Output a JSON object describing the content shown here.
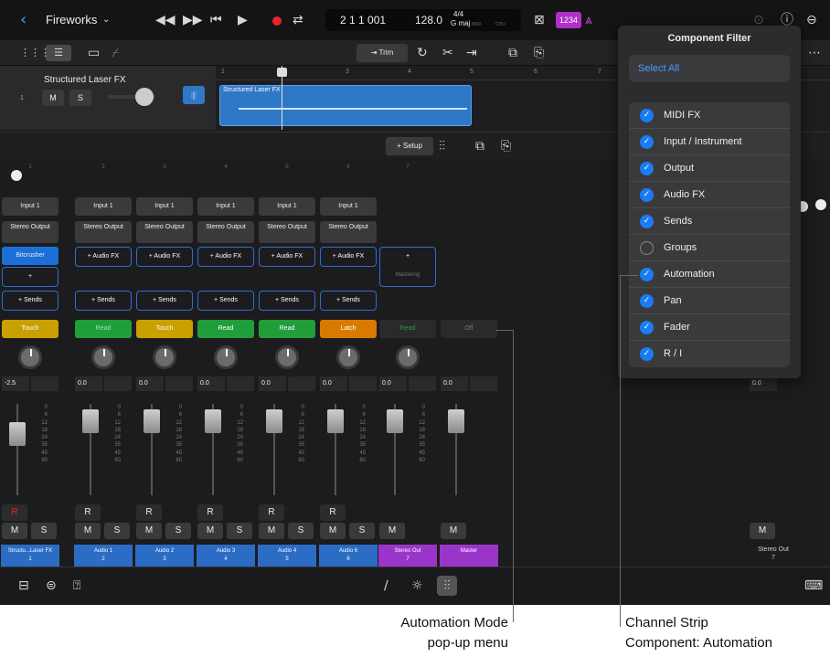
{
  "topbar": {
    "project_title": "Fireworks",
    "lcd_position": "2 1 1 001",
    "lcd_tempo": "128.0",
    "lcd_signature": "4/4",
    "lcd_key": "G maj",
    "lcd_midi": "MIDI",
    "lcd_cpu": "CPU",
    "count_in": "1234"
  },
  "toolbar2": {
    "trim_label": "Trim"
  },
  "track": {
    "number": "1",
    "name": "Structured Laser FX",
    "mute": "M",
    "solo": "S",
    "region_name": "Structured Laser FX",
    "ruler": [
      "1",
      "2",
      "3",
      "4",
      "5",
      "6",
      "7"
    ]
  },
  "mixbar": {
    "setup_label": "Setup"
  },
  "strips": [
    {
      "num": "1",
      "input": "Input 1",
      "output": "Stereo Output",
      "fx": "Bitcrusher",
      "audio_fx_add": "+",
      "sends": "+ Sends",
      "automation": "Touch",
      "pan": "-2.5",
      "rec": "R",
      "mute": "M",
      "solo": "S",
      "name": "Structu...Laser FX",
      "index": "1",
      "color": "#2b6cc4"
    },
    {
      "num": "2",
      "input": "Input 1",
      "output": "Stereo Output",
      "fx": "+ Audio FX",
      "sends": "+ Sends",
      "automation": "Read",
      "pan": "0.0",
      "rec": "R",
      "mute": "M",
      "solo": "S",
      "name": "Audio 1",
      "index": "2",
      "color": "#2b6cc4"
    },
    {
      "num": "3",
      "input": "Input 1",
      "output": "Stereo Output",
      "fx": "+ Audio FX",
      "sends": "+ Sends",
      "automation": "Touch",
      "pan": "0.0",
      "rec": "R",
      "mute": "M",
      "solo": "S",
      "name": "Audio 2",
      "index": "3",
      "color": "#2b6cc4"
    },
    {
      "num": "4",
      "input": "Input 1",
      "output": "Stereo Output",
      "fx": "+ Audio FX",
      "sends": "+ Sends",
      "automation": "Read",
      "pan": "0.0",
      "rec": "R",
      "mute": "M",
      "solo": "S",
      "name": "Audio 3",
      "index": "4",
      "color": "#2b6cc4"
    },
    {
      "num": "5",
      "input": "Input 1",
      "output": "Stereo Output",
      "fx": "+ Audio FX",
      "sends": "+ Sends",
      "automation": "Read",
      "pan": "0.0",
      "rec": "R",
      "mute": "M",
      "solo": "S",
      "name": "Audio 4",
      "index": "5",
      "color": "#2b6cc4"
    },
    {
      "num": "6",
      "input": "Input 1",
      "output": "Stereo Output",
      "fx": "+ Audio FX",
      "sends": "+ Sends",
      "automation": "Latch",
      "pan": "0.0",
      "rec": "R",
      "mute": "M",
      "solo": "S",
      "name": "Audio 6",
      "index": "6",
      "color": "#2b6cc4"
    },
    {
      "num": "7",
      "fx": "+",
      "mastering": "Mastering",
      "automation": "Read",
      "pan": "0.0",
      "mute": "M",
      "name": "Stereo Out",
      "index": "7",
      "color": "#9b35c9"
    },
    {
      "automation": "Off",
      "pan": "0.0",
      "mute": "M",
      "name": "Master",
      "index": "",
      "color": "#9b35c9"
    }
  ],
  "right_strip": {
    "pan": "0.0",
    "mute": "M",
    "name": "Stereo Out",
    "index": "7"
  },
  "fader_scale": [
    "0",
    "6",
    "12",
    "18",
    "24",
    "35",
    "45",
    "60"
  ],
  "automation_colors": {
    "Touch": "#c8a000",
    "Read": "#1f9e3a",
    "Latch": "#d97a00",
    "Off": "#3a3a3c"
  },
  "filter": {
    "title": "Component Filter",
    "select_all": "Select All",
    "items": [
      {
        "label": "MIDI FX",
        "checked": true
      },
      {
        "label": "Input / Instrument",
        "checked": true
      },
      {
        "label": "Output",
        "checked": true
      },
      {
        "label": "Audio FX",
        "checked": true
      },
      {
        "label": "Sends",
        "checked": true
      },
      {
        "label": "Groups",
        "checked": false
      },
      {
        "label": "Automation",
        "checked": true
      },
      {
        "label": "Pan",
        "checked": true
      },
      {
        "label": "Fader",
        "checked": true
      },
      {
        "label": "R / I",
        "checked": true
      }
    ]
  },
  "captions": {
    "left_line1": "Automation Mode",
    "left_line2": "pop-up menu",
    "right_line1": "Channel Strip",
    "right_line2": "Component: Automation"
  }
}
